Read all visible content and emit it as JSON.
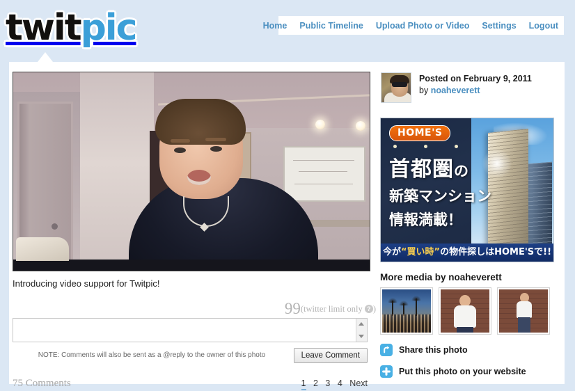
{
  "site": {
    "logo_part1": "twit",
    "logo_part2": "pic"
  },
  "nav": {
    "items": [
      {
        "label": "Home"
      },
      {
        "label": "Public Timeline"
      },
      {
        "label": "Upload Photo or Video"
      },
      {
        "label": "Settings"
      },
      {
        "label": "Logout"
      }
    ]
  },
  "media": {
    "caption": "Introducing video support for Twitpic!"
  },
  "comment_form": {
    "char_count": "99",
    "char_note": "(twitter limit only ",
    "char_note_end": ")",
    "help_glyph": "?",
    "input_value": "",
    "input_placeholder": "",
    "note": "NOTE: Comments will also be sent as a @reply to the owner of this photo",
    "submit_label": "Leave Comment"
  },
  "comments": {
    "count_label": "75 Comments",
    "pagination": [
      {
        "label": "1",
        "active": true
      },
      {
        "label": "2",
        "active": false
      },
      {
        "label": "3",
        "active": false
      },
      {
        "label": "4",
        "active": false
      },
      {
        "label": "Next",
        "active": false
      }
    ]
  },
  "post": {
    "posted_on": "Posted on February 9, 2011",
    "by_label": "by ",
    "username": "noaheverett"
  },
  "ad": {
    "brand": "HOME'S",
    "line1_big": "首都圏",
    "line1_small": "の",
    "line2": "新築マンション",
    "line3": "情報満載！",
    "bottom_pre": "今が",
    "bottom_quote": "“買い時”",
    "bottom_mid": "の物件探しは",
    "bottom_brand": "HOME'S",
    "bottom_post": "で!!"
  },
  "more_media": {
    "title": "More media by noaheverett",
    "thumbnails": [
      {
        "alt": "street-scene-at-dusk"
      },
      {
        "alt": "man-arms-crossed-brick-wall"
      },
      {
        "alt": "man-standing-brick-wall"
      }
    ]
  },
  "actions": [
    {
      "label": "Share this photo",
      "icon": "share-icon"
    },
    {
      "label": "Put this photo on your website",
      "icon": "plus-icon"
    }
  ],
  "colors": {
    "page_background": "#dbe7f4",
    "accent_link": "#4b8fc0",
    "logo_blue": "#3b9fd8",
    "icon_blue": "#49b0e4",
    "ad_orange": "#f2720e",
    "pagination_active_underline": "#7fb3d8"
  }
}
